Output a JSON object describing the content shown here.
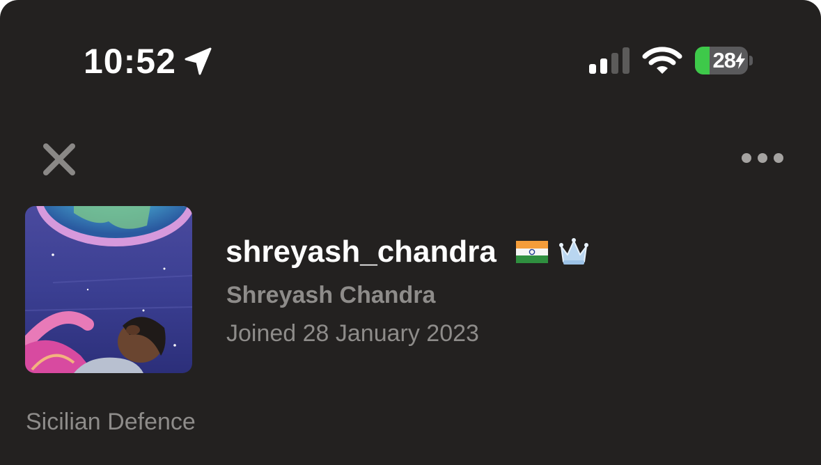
{
  "status_bar": {
    "time": "10:52",
    "battery_level": "28",
    "battery_fraction": 0.28,
    "battery_color": "#3ec94a",
    "icons": [
      "location-arrow-icon",
      "cellular-signal-icon",
      "wifi-icon",
      "battery-icon",
      "charging-bolt-icon"
    ]
  },
  "actions": {
    "close_icon": "close-icon",
    "more_icon": "more-horizontal-icon"
  },
  "profile": {
    "username": "shreyash_chandra",
    "full_name": "Shreyash Chandra",
    "joined": "Joined 28 January 2023",
    "bio": "Sicilian Defence",
    "flag_icon": "india-flag-icon",
    "badge_icon": "crown-icon"
  },
  "colors": {
    "background": "#232120",
    "text_primary": "#ffffff",
    "text_secondary": "#8e8c8a"
  }
}
